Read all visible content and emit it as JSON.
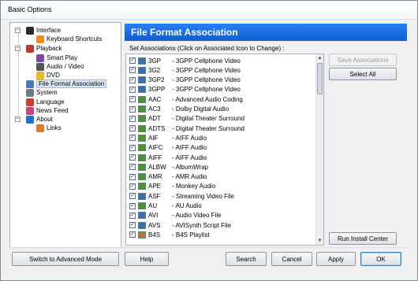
{
  "window": {
    "title": "Basic Options"
  },
  "tree": {
    "items": [
      {
        "label": "Interface",
        "icon": "monitor-icon",
        "color": "#2a2a2a"
      },
      {
        "label": "Keyboard Shortcuts",
        "icon": "keyboard-icon",
        "color": "#f28c1d"
      },
      {
        "label": "Playback",
        "icon": "playback-icon",
        "color": "#c0392b"
      },
      {
        "label": "Smart Play",
        "icon": "smart-play-icon",
        "color": "#7b4aa8"
      },
      {
        "label": "Audio / Video",
        "icon": "audio-video-icon",
        "color": "#555"
      },
      {
        "label": "DVD",
        "icon": "dvd-icon",
        "color": "#e8b923"
      },
      {
        "label": "File Format Association",
        "icon": "file-format-icon",
        "color": "#4a78b8"
      },
      {
        "label": "System",
        "icon": "system-icon",
        "color": "#6d7a88"
      },
      {
        "label": "Language",
        "icon": "language-icon",
        "color": "#d63b2f"
      },
      {
        "label": "News Feed",
        "icon": "news-feed-icon",
        "color": "#c04a7a"
      },
      {
        "label": "About",
        "icon": "about-icon",
        "color": "#1f6fd0"
      },
      {
        "label": "Links",
        "icon": "links-icon",
        "color": "#e07b24"
      }
    ]
  },
  "panel": {
    "title": "File Format Association",
    "caption": "Set Associations (Click on Associated Icon to Change) :"
  },
  "associations": [
    {
      "ext": "3GP",
      "desc": "- 3GPP Cellphone Video",
      "icon_color": "#3a6fb0"
    },
    {
      "ext": "3G2",
      "desc": "- 3GPP Cellphone Video",
      "icon_color": "#3a6fb0"
    },
    {
      "ext": "3GP2",
      "desc": "- 3GPP Cellphone Video",
      "icon_color": "#3a6fb0"
    },
    {
      "ext": "3GPP",
      "desc": "- 3GPP Cellphone Video",
      "icon_color": "#3a6fb0"
    },
    {
      "ext": "AAC",
      "desc": "- Advanced Audio Coding",
      "icon_color": "#4f8f3a"
    },
    {
      "ext": "AC3",
      "desc": "- Dolby Digital Audio",
      "icon_color": "#4f8f3a"
    },
    {
      "ext": "ADT",
      "desc": "- Digital Theater Surround",
      "icon_color": "#4f8f3a"
    },
    {
      "ext": "ADTS",
      "desc": "- Digital Theater Surround",
      "icon_color": "#4f8f3a"
    },
    {
      "ext": "AIF",
      "desc": "- AIFF Audio",
      "icon_color": "#4f8f3a"
    },
    {
      "ext": "AIFC",
      "desc": "- AIFF Audio",
      "icon_color": "#4f8f3a"
    },
    {
      "ext": "AIFF",
      "desc": "- AIFF Audio",
      "icon_color": "#4f8f3a"
    },
    {
      "ext": "ALBW",
      "desc": "- AlbumWrap",
      "icon_color": "#4f8f3a"
    },
    {
      "ext": "AMR",
      "desc": "- AMR Audio",
      "icon_color": "#4f8f3a"
    },
    {
      "ext": "APE",
      "desc": "- Monkey Audio",
      "icon_color": "#4f8f3a"
    },
    {
      "ext": "ASF",
      "desc": "- Streaming Video File",
      "icon_color": "#3a6fb0"
    },
    {
      "ext": "AU",
      "desc": "- AU Audio",
      "icon_color": "#4f8f3a"
    },
    {
      "ext": "AVI",
      "desc": "- Audio Video File",
      "icon_color": "#3a6fb0"
    },
    {
      "ext": "AVS",
      "desc": "- AVISynth Script File",
      "icon_color": "#3a6fb0"
    },
    {
      "ext": "B4S",
      "desc": "- B4S Playlist",
      "icon_color": "#b07a3a"
    }
  ],
  "side_buttons": {
    "save": "Save Associations",
    "select_all": "Select All",
    "run_install": "Run Install Center"
  },
  "bottom_buttons": {
    "advanced": "Switch to Advanced Mode",
    "help": "Help",
    "search": "Search",
    "cancel": "Cancel",
    "apply": "Apply",
    "ok": "OK"
  }
}
